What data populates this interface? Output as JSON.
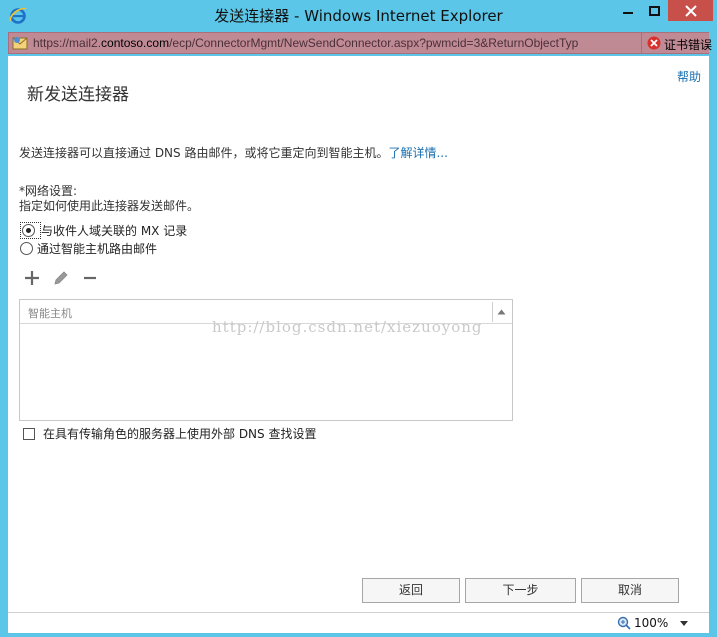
{
  "window": {
    "title": "发送连接器 - Windows Internet Explorer"
  },
  "address": {
    "url_prefix": "https://mail2.",
    "url_host": "contoso.com",
    "url_rest": "/ecp/ConnectorMgmt/NewSendConnector.aspx?pwmcid=3&ReturnObjectTyp",
    "cert_error": "证书错误"
  },
  "page": {
    "help": "帮助",
    "title": "新发送连接器",
    "description": "发送连接器可以直接通过 DNS 路由邮件，或将它重定向到智能主机。",
    "learn_more": "了解详情...",
    "network_label": "*网络设置:",
    "network_sub": "指定如何使用此连接器发送邮件。",
    "radio_mx": "与收件人域关联的 MX 记录",
    "radio_smarthost": "通过智能主机路由邮件",
    "grid_column": "智能主机",
    "watermark": "http://blog.csdn.net/xiezuoyong",
    "checkbox_dns": "在具有传输角色的服务器上使用外部 DNS 查找设置"
  },
  "buttons": {
    "back": "返回",
    "next": "下一步",
    "cancel": "取消"
  },
  "status": {
    "zoom": "100%"
  },
  "icons": {
    "browser": "ie-logo-icon",
    "add": "plus-icon",
    "edit": "pencil-icon",
    "remove": "minus-icon"
  }
}
